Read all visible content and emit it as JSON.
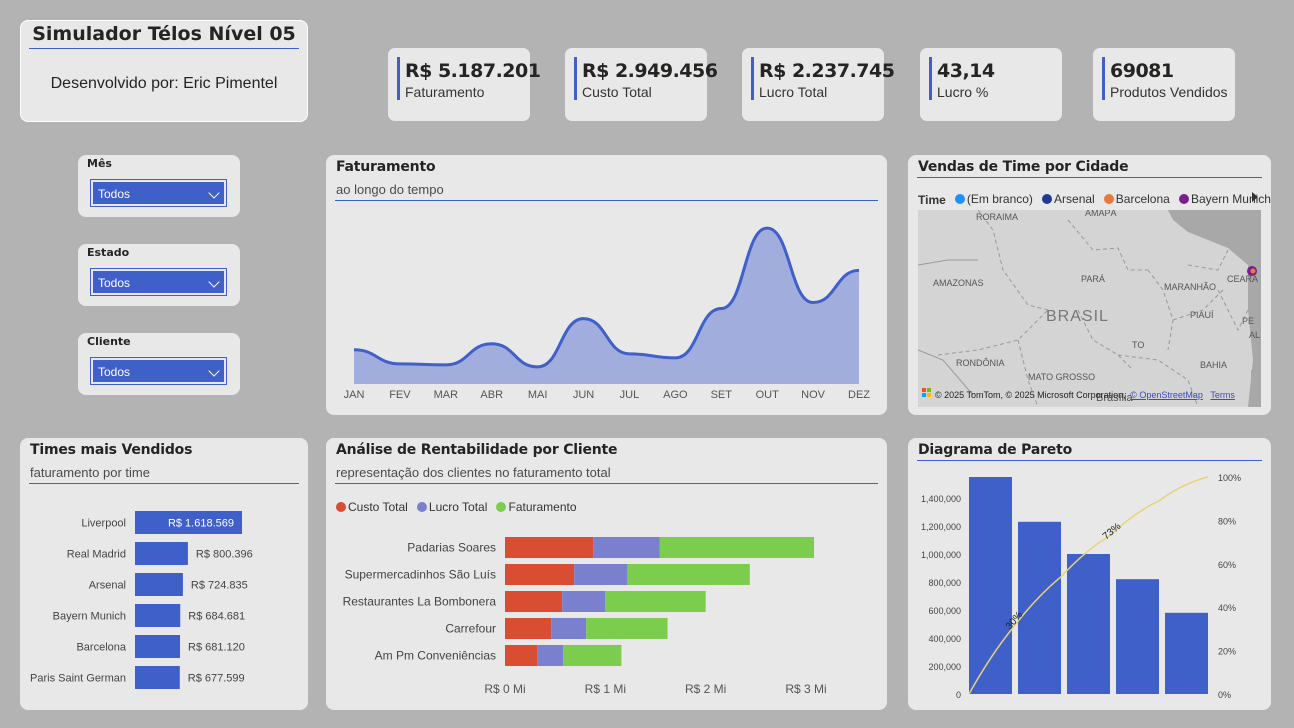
{
  "header": {
    "title": "Simulador Télos Nível 05",
    "subtitle": "Desenvolvido por: Eric Pimentel"
  },
  "kpis": [
    {
      "value": "R$ 5.187.201",
      "label": "Faturamento"
    },
    {
      "value": "R$ 2.949.456",
      "label": "Custo Total"
    },
    {
      "value": "R$ 2.237.745",
      "label": "Lucro Total"
    },
    {
      "value": "43,14",
      "label": "Lucro %"
    },
    {
      "value": "69081",
      "label": "Produtos Vendidos"
    }
  ],
  "slicers": [
    {
      "label": "Mês",
      "value": "Todos"
    },
    {
      "label": "Estado",
      "value": "Todos"
    },
    {
      "label": "Cliente",
      "value": "Todos"
    }
  ],
  "colors": {
    "accent": "#3f5fc9",
    "area_fill": "#a1aedd",
    "custo": "#d94d33",
    "lucro": "#7a7fce",
    "faturamento": "#7ccc4e",
    "pareto_line": "#e8d27a"
  },
  "revenue_chart": {
    "title": "Faturamento",
    "subtitle": "ao longo do tempo"
  },
  "map": {
    "title": "Vendas de Time por Cidade",
    "legend_title": "Time",
    "legend": [
      {
        "name": "(Em branco)",
        "color": "#1e90ff"
      },
      {
        "name": "Arsenal",
        "color": "#1f3a93"
      },
      {
        "name": "Barcelona",
        "color": "#e8793a"
      },
      {
        "name": "Bayern Munich",
        "color": "#7b1f8a"
      }
    ],
    "labels": {
      "roraima": "RORAIMA",
      "amapa": "AMAPÁ",
      "amazonas": "AMAZONAS",
      "para": "PARÁ",
      "maranhao": "MARANHÃO",
      "ceara": "CEARÁ",
      "brasil": "BRASIL",
      "piaui": "PIAUÍ",
      "pe": "PE",
      "al": "AL",
      "to": "TO",
      "rondonia": "RONDÔNIA",
      "bahia": "BAHIA",
      "mato_grosso": "MATO GROSSO",
      "brasilia": "Brasília"
    },
    "copyright": "© 2025 TomTom, © 2025 Microsoft Corporation,",
    "osm": "© OpenStreetMap",
    "terms": "Terms",
    "logo_text": "Microsoft Bing"
  },
  "teams_chart": {
    "title": "Times mais Vendidos",
    "subtitle": "faturamento por time"
  },
  "profit_chart": {
    "title": "Análise de Rentabilidade por Cliente",
    "subtitle": "representação dos clientes no faturamento total",
    "legend": [
      "Custo Total",
      "Lucro Total",
      "Faturamento"
    ]
  },
  "pareto_chart": {
    "title": "Diagrama de Pareto"
  },
  "chart_data": [
    {
      "type": "area",
      "title": "Faturamento",
      "subtitle": "ao longo do tempo",
      "categories": [
        "JAN",
        "FEV",
        "MAR",
        "ABR",
        "MAI",
        "JUN",
        "JUL",
        "AGO",
        "SET",
        "OUT",
        "NOV",
        "DEZ"
      ],
      "values": [
        340000,
        200000,
        190000,
        400000,
        170000,
        650000,
        300000,
        260000,
        750000,
        1550000,
        810000,
        1130000
      ],
      "ylim": [
        0,
        1700000
      ]
    },
    {
      "type": "bar",
      "orientation": "horizontal",
      "title": "Times mais Vendidos",
      "categories": [
        "Liverpool",
        "Real Madrid",
        "Arsenal",
        "Bayern Munich",
        "Barcelona",
        "Paris Saint German"
      ],
      "values": [
        1618569,
        800396,
        724835,
        684681,
        681120,
        677599
      ],
      "data_labels": [
        "R$ 1.618.569",
        "R$ 800.396",
        "R$ 724.835",
        "R$ 684.681",
        "R$ 681.120",
        "R$ 677.599"
      ]
    },
    {
      "type": "bar",
      "orientation": "horizontal",
      "stacked": true,
      "title": "Análise de Rentabilidade por Cliente",
      "categories": [
        "Padarias Soares",
        "Supermercadinhos São Luís",
        "Restaurantes La Bombonera",
        "Carrefour",
        "Am Pm Conveniências"
      ],
      "series": [
        {
          "name": "Custo Total",
          "values": [
            880000,
            690000,
            570000,
            460000,
            320000
          ]
        },
        {
          "name": "Lucro Total",
          "values": [
            660000,
            530000,
            430000,
            350000,
            260000
          ]
        },
        {
          "name": "Faturamento",
          "values": [
            1540000,
            1220000,
            1000000,
            810000,
            580000
          ]
        }
      ],
      "x_ticks": [
        "R$ 0 Mi",
        "R$ 1 Mi",
        "R$ 2 Mi",
        "R$ 3 Mi"
      ],
      "xlim": [
        0,
        3000000
      ]
    },
    {
      "type": "bar",
      "title": "Diagrama de Pareto",
      "values": [
        1550000,
        1230000,
        1000000,
        820000,
        580000
      ],
      "line_cumulative_pct": [
        30,
        54,
        73,
        89,
        100
      ],
      "line_labels": [
        "30%",
        "73%"
      ],
      "y_ticks": [
        "0",
        "200,000",
        "400,000",
        "600,000",
        "800,000",
        "1,000,000",
        "1,200,000",
        "1,400,000"
      ],
      "y2_ticks": [
        "0%",
        "20%",
        "40%",
        "60%",
        "80%",
        "100%"
      ],
      "ylim": [
        0,
        1550000
      ]
    }
  ]
}
